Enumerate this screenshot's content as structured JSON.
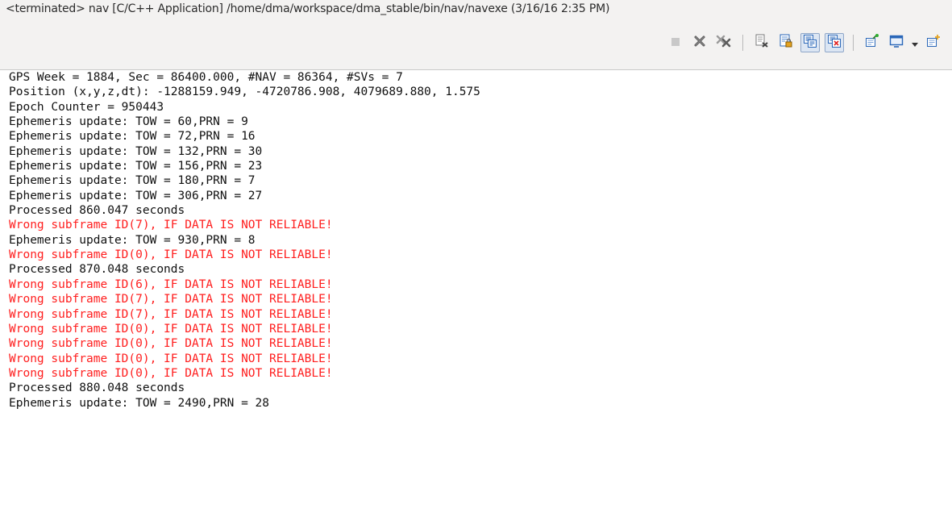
{
  "console": {
    "title": "<terminated> nav [C/C++ Application] /home/dma/workspace/dma_stable/bin/nav/navexe (3/16/16 2:35 PM)"
  },
  "toolbar": {
    "buttons": [
      {
        "name": "terminate-icon",
        "state": "disabled"
      },
      {
        "name": "remove-launch-icon",
        "state": "normal"
      },
      {
        "name": "remove-all-terminated-icon",
        "state": "normal"
      },
      {
        "name": "clear-console-icon",
        "state": "normal"
      },
      {
        "name": "scroll-lock-icon",
        "state": "normal"
      },
      {
        "name": "show-console-on-stdout-icon",
        "state": "pressed"
      },
      {
        "name": "show-console-on-stderr-icon",
        "state": "pressed"
      },
      {
        "name": "pin-console-icon",
        "state": "normal"
      },
      {
        "name": "display-selected-console-icon",
        "state": "normal"
      },
      {
        "name": "chevron-down-icon",
        "state": "normal"
      },
      {
        "name": "open-console-icon",
        "state": "normal"
      }
    ],
    "colors": {
      "accent": "#2a67b8",
      "error": "#ff1e1e",
      "pressed_bg": "#dce6f3"
    }
  },
  "output": {
    "lines": [
      {
        "text": "GPS Week = 1884, Sec = 86400.000, #NAV = 86364, #SVs = 7",
        "type": "out"
      },
      {
        "text": "Position (x,y,z,dt): -1288159.949, -4720786.908, 4079689.880, 1.575",
        "type": "out"
      },
      {
        "text": "Epoch Counter = 950443",
        "type": "out"
      },
      {
        "text": "Ephemeris update: TOW = 60,PRN = 9",
        "type": "out"
      },
      {
        "text": "Ephemeris update: TOW = 72,PRN = 16",
        "type": "out"
      },
      {
        "text": "Ephemeris update: TOW = 132,PRN = 30",
        "type": "out"
      },
      {
        "text": "Ephemeris update: TOW = 156,PRN = 23",
        "type": "out"
      },
      {
        "text": "Ephemeris update: TOW = 180,PRN = 7",
        "type": "out"
      },
      {
        "text": "Ephemeris update: TOW = 306,PRN = 27",
        "type": "out"
      },
      {
        "text": "Processed 860.047 seconds",
        "type": "out"
      },
      {
        "text": "Wrong subframe ID(7), IF DATA IS NOT RELIABLE!",
        "type": "err"
      },
      {
        "text": "Ephemeris update: TOW = 930,PRN = 8",
        "type": "out"
      },
      {
        "text": "Wrong subframe ID(0), IF DATA IS NOT RELIABLE!",
        "type": "err"
      },
      {
        "text": "Processed 870.048 seconds",
        "type": "out"
      },
      {
        "text": "Wrong subframe ID(6), IF DATA IS NOT RELIABLE!",
        "type": "err"
      },
      {
        "text": "Wrong subframe ID(7), IF DATA IS NOT RELIABLE!",
        "type": "err"
      },
      {
        "text": "Wrong subframe ID(7), IF DATA IS NOT RELIABLE!",
        "type": "err"
      },
      {
        "text": "Wrong subframe ID(0), IF DATA IS NOT RELIABLE!",
        "type": "err"
      },
      {
        "text": "Wrong subframe ID(0), IF DATA IS NOT RELIABLE!",
        "type": "err"
      },
      {
        "text": "Wrong subframe ID(0), IF DATA IS NOT RELIABLE!",
        "type": "err"
      },
      {
        "text": "Wrong subframe ID(0), IF DATA IS NOT RELIABLE!",
        "type": "err"
      },
      {
        "text": "Processed 880.048 seconds",
        "type": "out"
      },
      {
        "text": "Ephemeris update: TOW = 2490,PRN = 28",
        "type": "out"
      }
    ]
  }
}
